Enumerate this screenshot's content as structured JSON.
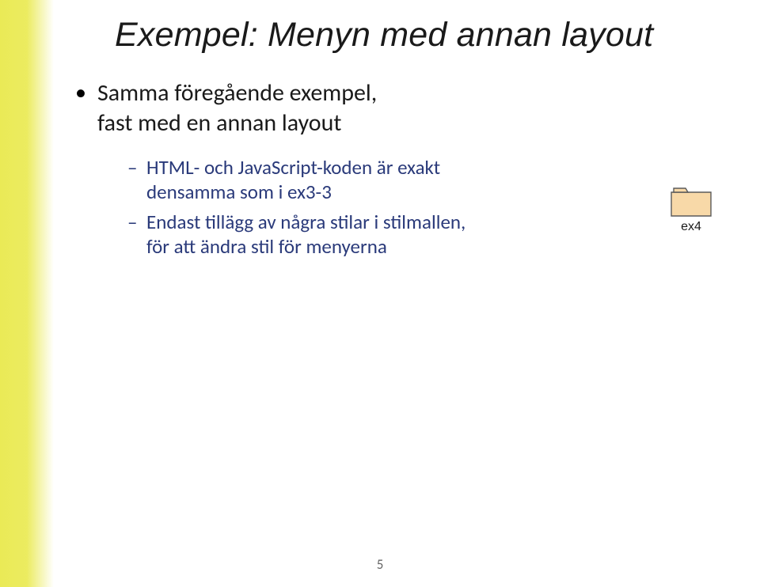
{
  "title": "Exempel: Menyn med annan layout",
  "bullets": {
    "l1_line1": "Samma föregående exempel,",
    "l1_line2": "fast med en annan layout",
    "l2a_line1": "HTML- och JavaScript-koden är exakt",
    "l2a_line2": "densamma som i ex3-3",
    "l2b_line1": "Endast tillägg av några stilar i stilmallen,",
    "l2b_line2": "för att ändra stil för menyerna"
  },
  "folder": {
    "label": "ex4"
  },
  "pageNumber": "5"
}
